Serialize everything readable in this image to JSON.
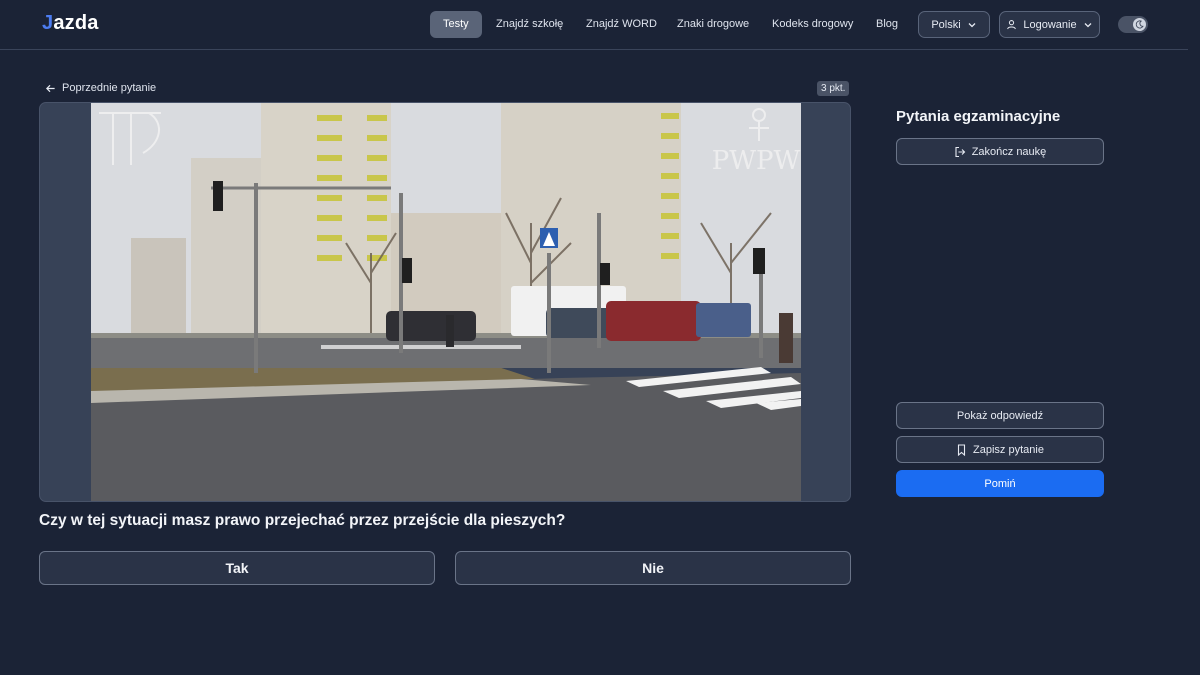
{
  "brand": {
    "logo_prefix": "J",
    "logo_rest": "azda"
  },
  "nav": {
    "items": [
      {
        "label": "Testy",
        "active": true
      },
      {
        "label": "Znajdź szkołę"
      },
      {
        "label": "Znajdź WORD"
      },
      {
        "label": "Znaki drogowe"
      },
      {
        "label": "Kodeks drogowy"
      },
      {
        "label": "Blog"
      }
    ],
    "language": "Polski",
    "login": "Logowanie",
    "theme_toggle_icon": "moon-icon"
  },
  "question": {
    "prev_label": "Poprzednie pytanie",
    "points": "3 pkt.",
    "text": "Czy w tej sytuacji masz prawo przejechać przez przejście dla pieszych?",
    "answers": [
      "Tak",
      "Nie"
    ],
    "watermark": "PWPW"
  },
  "sidebar": {
    "title": "Pytania egzaminacyjne",
    "finish_label": "Zakończ naukę",
    "show_answer_label": "Pokaż odpowiedź",
    "save_label": "Zapisz pytanie",
    "skip_label": "Pomiń"
  },
  "colors": {
    "background": "#1b2336",
    "primary": "#1b6cf2",
    "accent": "#4c7cf0"
  }
}
